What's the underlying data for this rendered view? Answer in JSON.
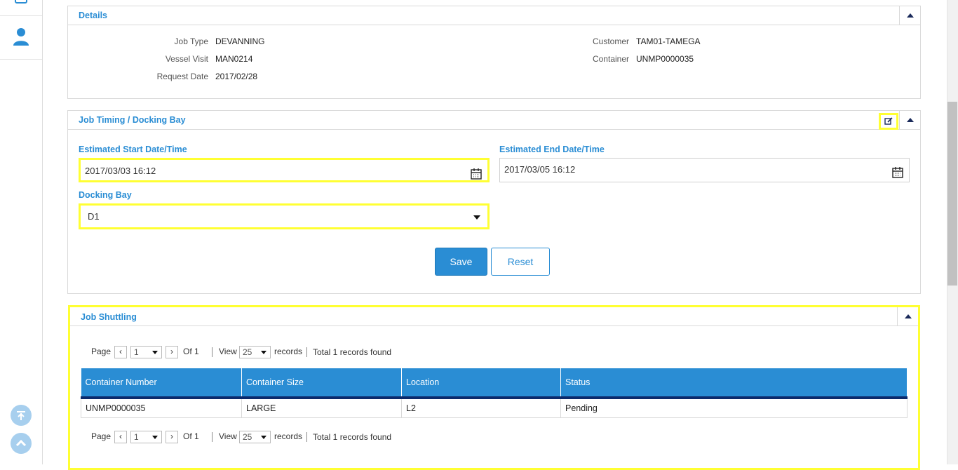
{
  "rail": {
    "icons": [
      "calendar-icon",
      "user-icon",
      "scroll-to-bottom-icon",
      "scroll-to-top-icon"
    ]
  },
  "details": {
    "title": "Details",
    "job_type_label": "Job Type",
    "job_type_value": "DEVANNING",
    "vessel_visit_label": "Vessel Visit",
    "vessel_visit_value": "MAN0214",
    "request_date_label": "Request Date",
    "request_date_value": "2017/02/28",
    "customer_label": "Customer",
    "customer_value": "TAM01-TAMEGA",
    "container_label": "Container",
    "container_value": "UNMP0000035"
  },
  "timing": {
    "title": "Job Timing / Docking Bay",
    "start_label": "Estimated Start Date/Time",
    "start_value": "2017/03/03 16:12",
    "end_label": "Estimated End Date/Time",
    "end_value": "2017/03/05 16:12",
    "bay_label": "Docking Bay",
    "bay_value": "D1",
    "save_label": "Save",
    "reset_label": "Reset"
  },
  "shuttling": {
    "title": "Job Shuttling",
    "pager": {
      "page_label": "Page",
      "page_value": "1",
      "of_label": "Of 1",
      "view_label": "View",
      "view_value": "25",
      "records_label": "records",
      "total_label": "Total 1 records found"
    },
    "columns": [
      "Container Number",
      "Container Size",
      "Location",
      "Status"
    ],
    "rows": [
      [
        "UNMP0000035",
        "LARGE",
        "L2",
        "Pending"
      ]
    ]
  },
  "colors": {
    "accent": "#2a8dd4",
    "highlight": "#ffff33",
    "table_rule": "#0b2a6b"
  }
}
